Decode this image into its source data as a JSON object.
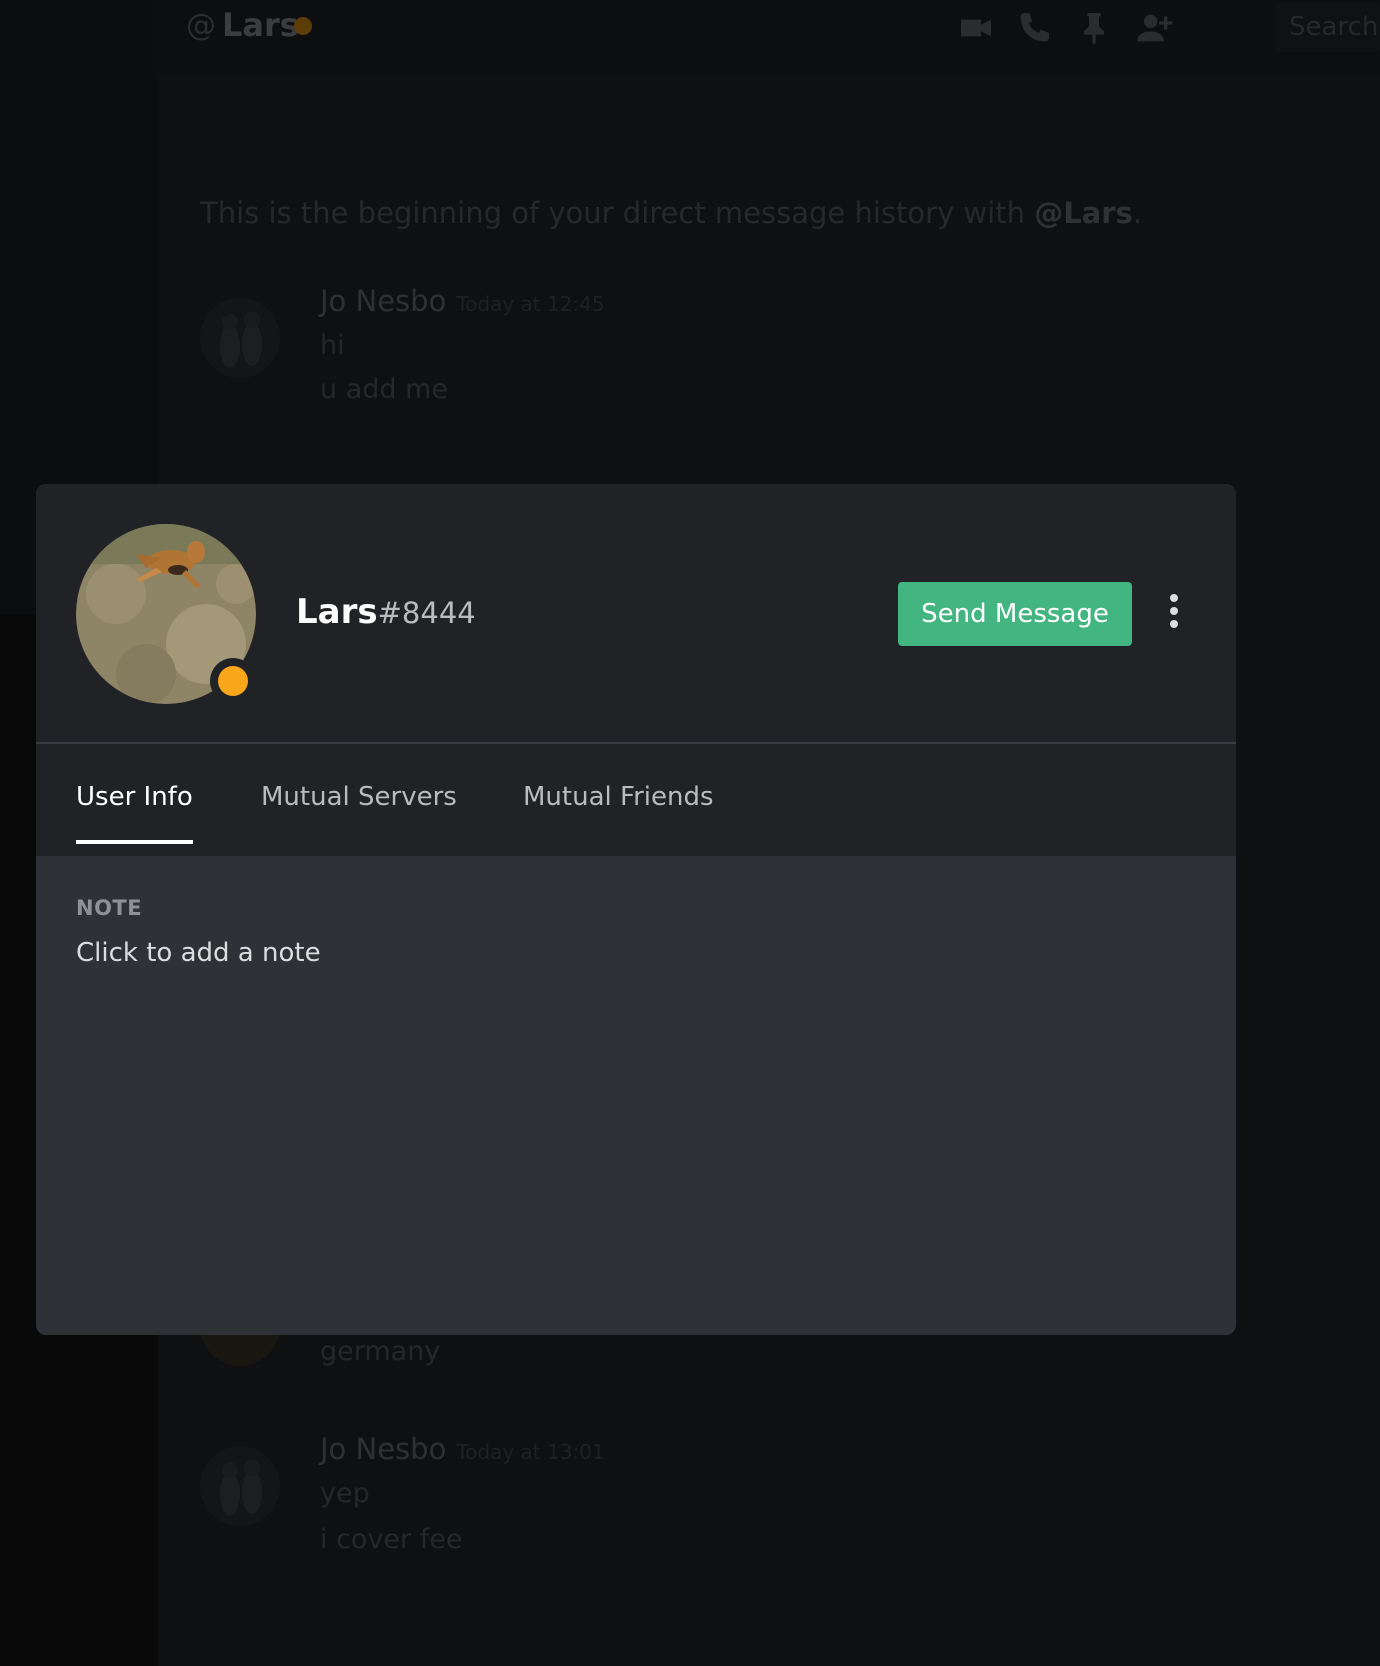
{
  "header": {
    "at_symbol": "@",
    "channel_name": "Lars",
    "status_color": "#faa61a",
    "icons": [
      "video-camera-icon",
      "phone-icon",
      "pin-icon",
      "add-friend-icon"
    ],
    "search_placeholder": "Search"
  },
  "chat": {
    "intro_prefix": "This is the beginning of your direct message history with ",
    "intro_mention": "@Lars",
    "intro_suffix": ".",
    "messages": [
      {
        "author": "Jo Nesbo",
        "time": "Today at 12:45",
        "lines": [
          "hi",
          "u add me"
        ]
      },
      {
        "author": "",
        "time": "",
        "lines": [
          "germany"
        ]
      },
      {
        "author": "Jo Nesbo",
        "time": "Today at 13:01",
        "lines": [
          "yep",
          "i cover fee"
        ]
      }
    ]
  },
  "profile": {
    "username": "Lars",
    "discriminator": "#8444",
    "status": "idle",
    "send_message_label": "Send Message",
    "tabs": [
      {
        "label": "User Info",
        "active": true
      },
      {
        "label": "Mutual Servers",
        "active": false
      },
      {
        "label": "Mutual Friends",
        "active": false
      }
    ],
    "note_heading": "NOTE",
    "note_placeholder": "Click to add a note"
  },
  "colors": {
    "accent_green": "#43b581",
    "idle_yellow": "#faa61a",
    "modal_bg": "#2f3136",
    "header_bg": "#202225"
  }
}
